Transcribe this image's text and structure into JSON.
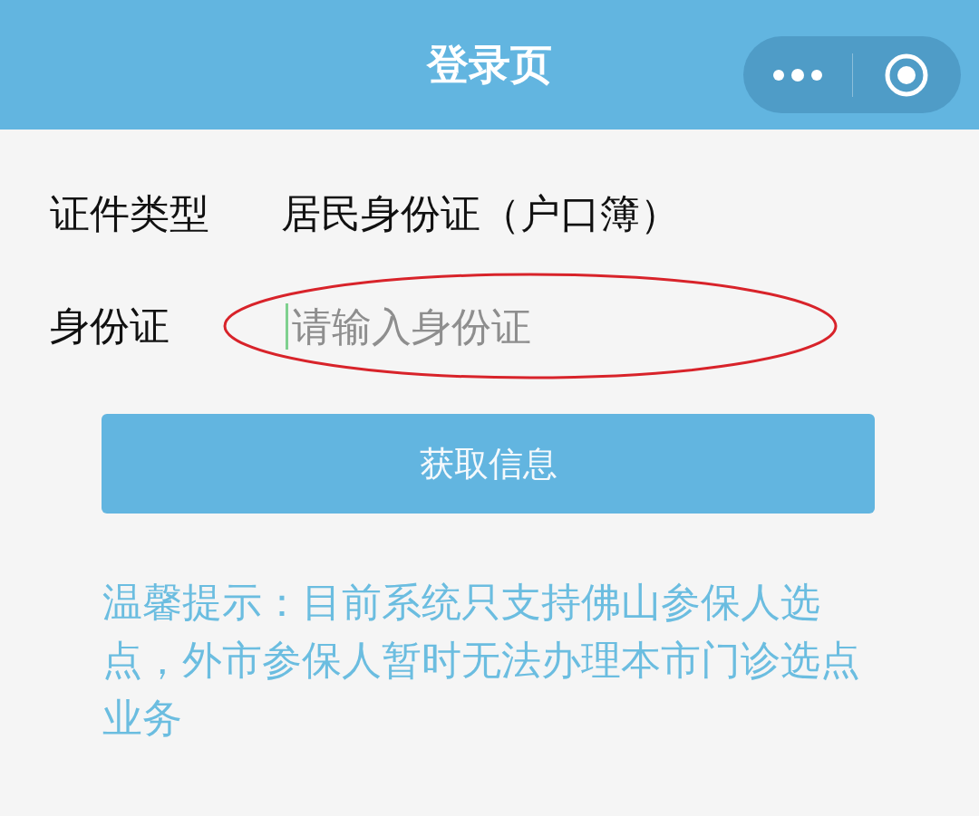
{
  "nav_bar": {
    "title": "登录页"
  },
  "form": {
    "rows": [
      {
        "kind": "value",
        "label": "证件类型",
        "value": "居民身份证（户口簿）"
      },
      {
        "kind": "input",
        "label": "身份证",
        "placeholder": "请输入身份证",
        "focused": true,
        "highlighted": true
      }
    ]
  },
  "submit_button": {
    "label": "获取信息"
  },
  "notice": "温馨提示：目前系统只支持佛山参保人选点，外市参保人暂时无法办理本市门诊选点业务"
}
